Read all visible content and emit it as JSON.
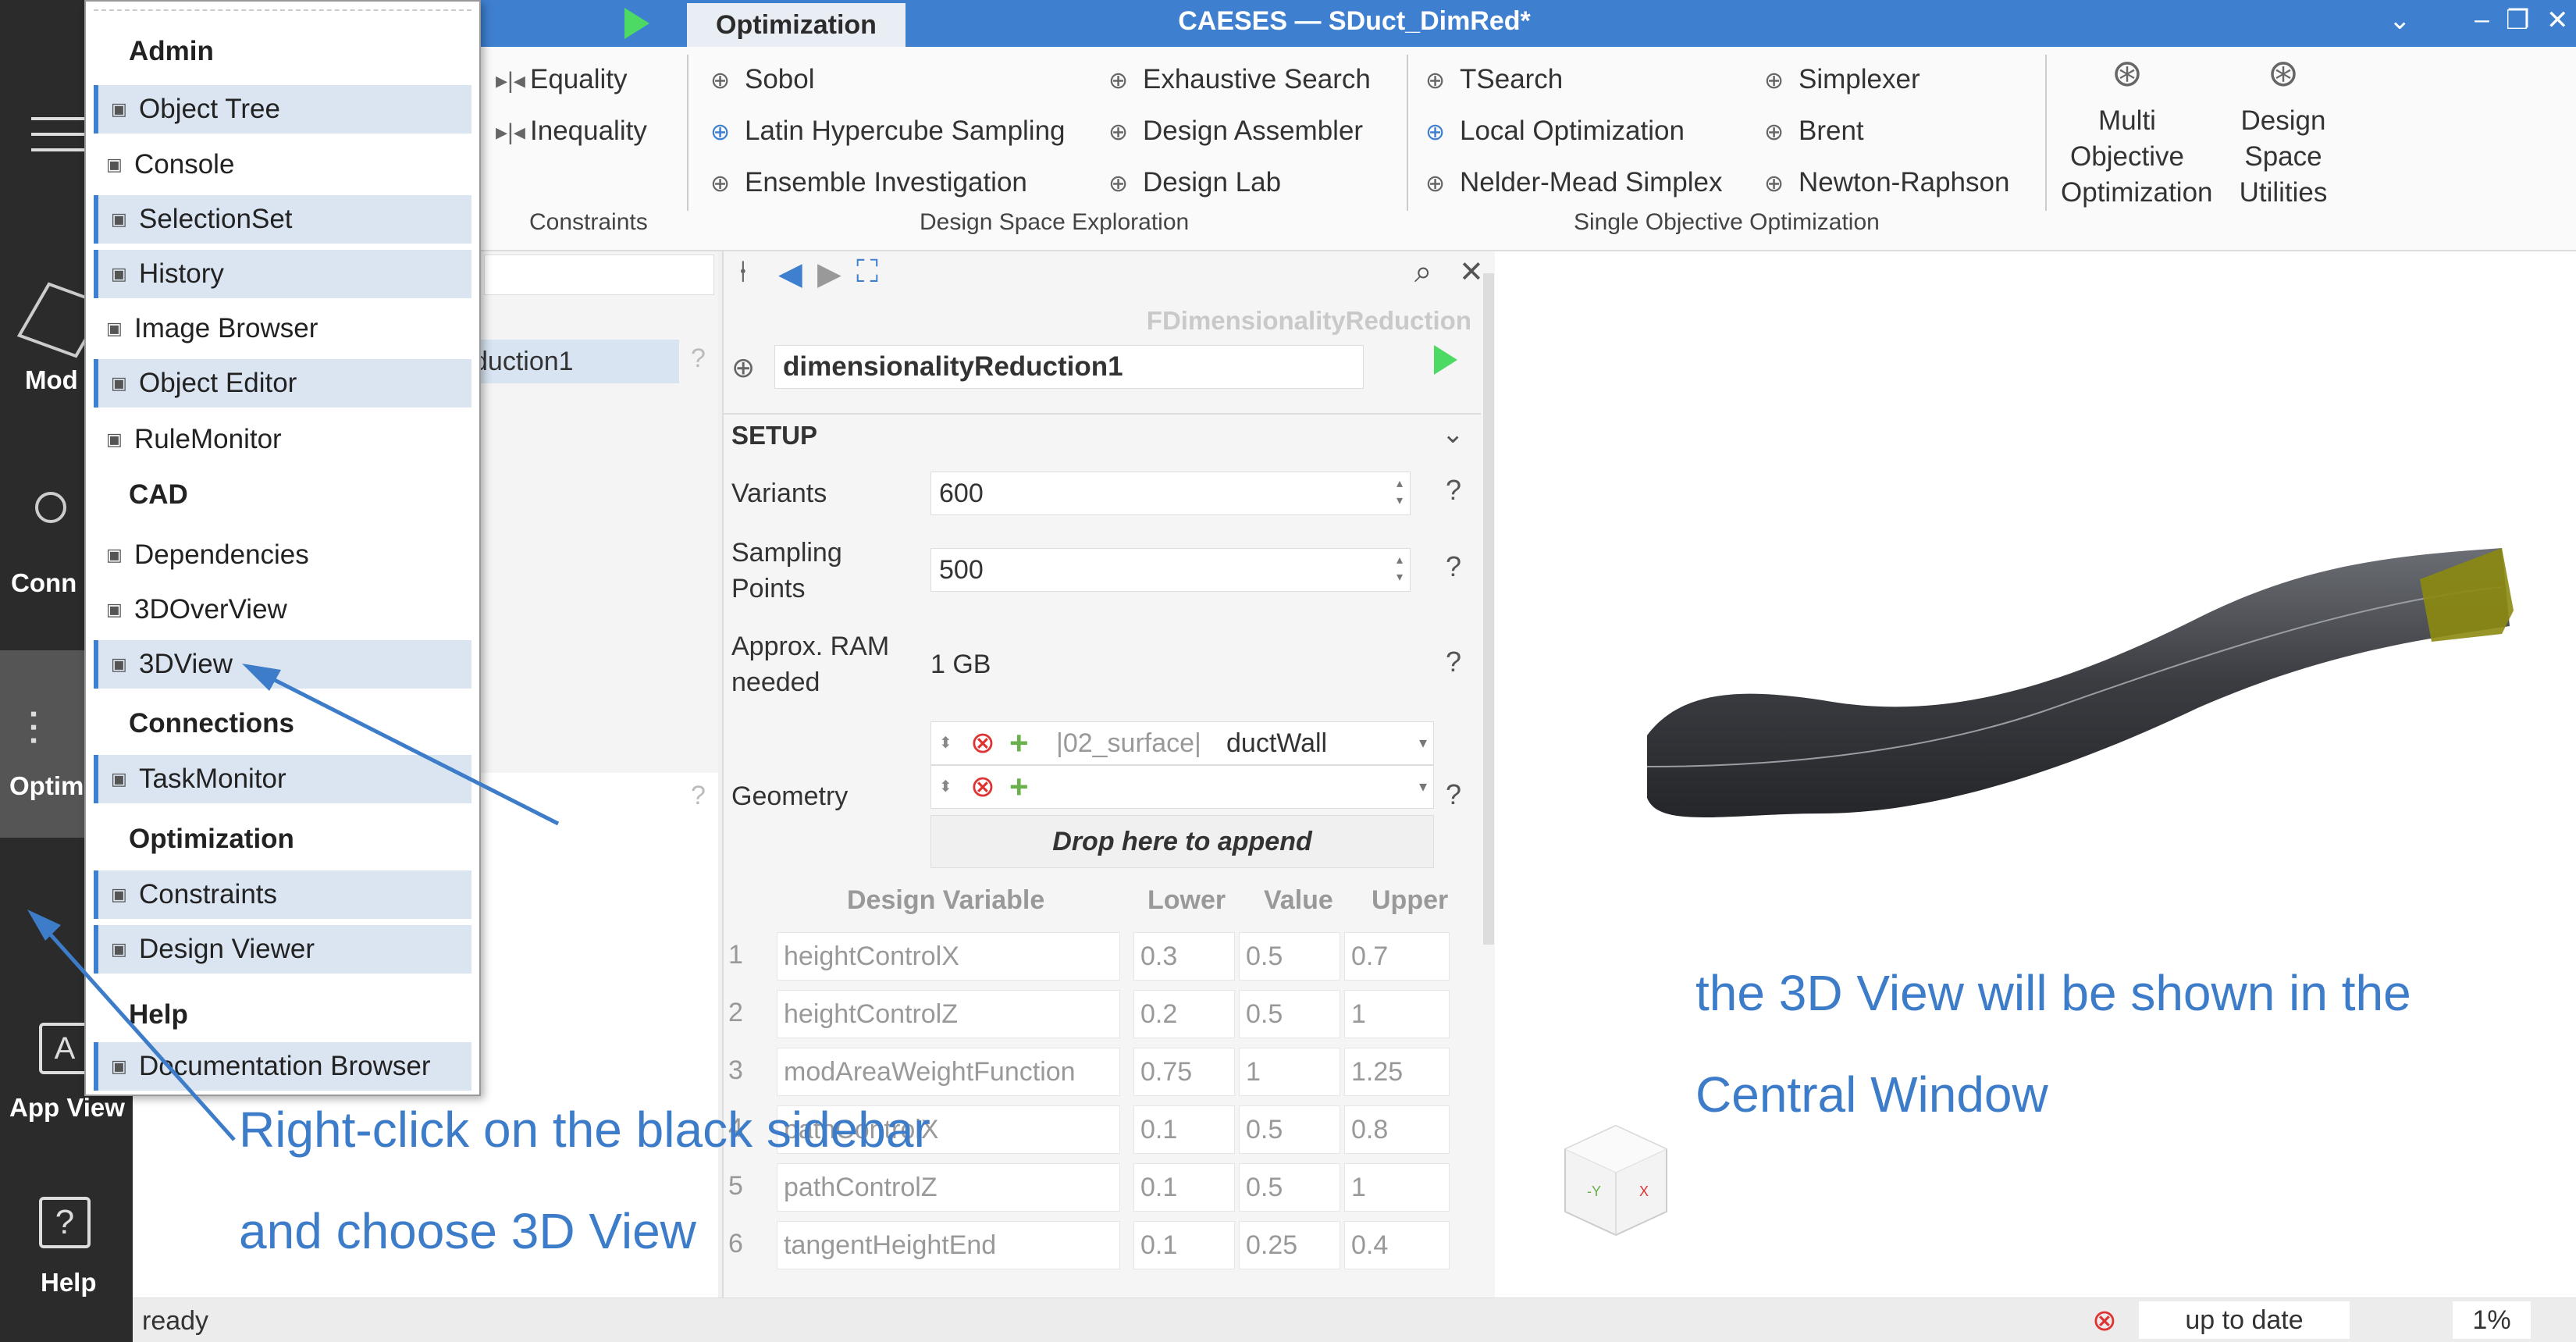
{
  "titlebar": {
    "tab": "Optimization",
    "title": "CAESES — SDuct_DimRed*"
  },
  "left_bar": {
    "model": "Mod",
    "conn": "Conn",
    "optim": "Optim",
    "app_view": "App View",
    "help": "Help"
  },
  "ribbon": {
    "equality": "Equality",
    "inequality": "Inequality",
    "group_constraints": "Constraints",
    "sobol": "Sobol",
    "latin": "Latin Hypercube Sampling",
    "ensemble": "Ensemble Investigation",
    "exhaustive": "Exhaustive Search",
    "assembler": "Design Assembler",
    "lab": "Design Lab",
    "group_dse": "Design Space Exploration",
    "tsearch": "TSearch",
    "local": "Local Optimization",
    "nelder": "Nelder-Mead Simplex",
    "simplexer": "Simplexer",
    "brent": "Brent",
    "newton": "Newton-Raphson",
    "group_soo": "Single Objective Optimization",
    "multi": [
      "Multi",
      "Objective",
      "Optimization"
    ],
    "dsu": [
      "Design",
      "Space",
      "Utilities"
    ]
  },
  "tree": {
    "selected": "duction1"
  },
  "editor": {
    "type": "FDimensionalityReduction",
    "name": "dimensionalityReduction1",
    "setup": "SETUP",
    "variants_label": "Variants",
    "variants_value": "600",
    "sampling_label": [
      "Sampling",
      "Points"
    ],
    "sampling_value": "500",
    "ram_label": [
      "Approx. RAM",
      "needed"
    ],
    "ram_value": "1 GB",
    "geometry_label": "Geometry",
    "geometry_prefix": "|02_surface|",
    "geometry_value": "ductWall",
    "drop": "Drop here to append",
    "dv_headers": [
      "Design Variable",
      "Lower",
      "Value",
      "Upper"
    ],
    "dv_rows": [
      {
        "n": "1",
        "name": "heightControlX",
        "lower": "0.3",
        "value": "0.5",
        "upper": "0.7"
      },
      {
        "n": "2",
        "name": "heightControlZ",
        "lower": "0.2",
        "value": "0.5",
        "upper": "1"
      },
      {
        "n": "3",
        "name": "modAreaWeightFunction",
        "lower": "0.75",
        "value": "1",
        "upper": "1.25"
      },
      {
        "n": "4",
        "name": "pathControlX",
        "lower": "0.1",
        "value": "0.5",
        "upper": "0.8"
      },
      {
        "n": "5",
        "name": "pathControlZ",
        "lower": "0.1",
        "value": "0.5",
        "upper": "1"
      },
      {
        "n": "6",
        "name": "tangentHeightEnd",
        "lower": "0.1",
        "value": "0.25",
        "upper": "0.4"
      }
    ]
  },
  "menu": {
    "sections": [
      "Admin",
      "CAD",
      "Connections",
      "Optimization",
      "Help"
    ],
    "items": [
      "Object Tree",
      "Console",
      "SelectionSet",
      "History",
      "Image Browser",
      "Object Editor",
      "RuleMonitor",
      "Dependencies",
      "3DOverView",
      "3DView",
      "TaskMonitor",
      "Constraints",
      "Design Viewer",
      "Documentation Browser"
    ]
  },
  "annotations": {
    "left_1": "Right-click on the black sidebar",
    "left_2": "and choose 3D View",
    "right_1": "the 3D View will be shown in the",
    "right_2": "Central Window"
  },
  "status": {
    "left": "ready",
    "state": "up to date",
    "percent": "1%"
  },
  "colors": {
    "accent": "#3f7fd0",
    "annotation": "#3d7cc9",
    "sidebar": "#2b2b2b",
    "play": "#4cd964"
  }
}
